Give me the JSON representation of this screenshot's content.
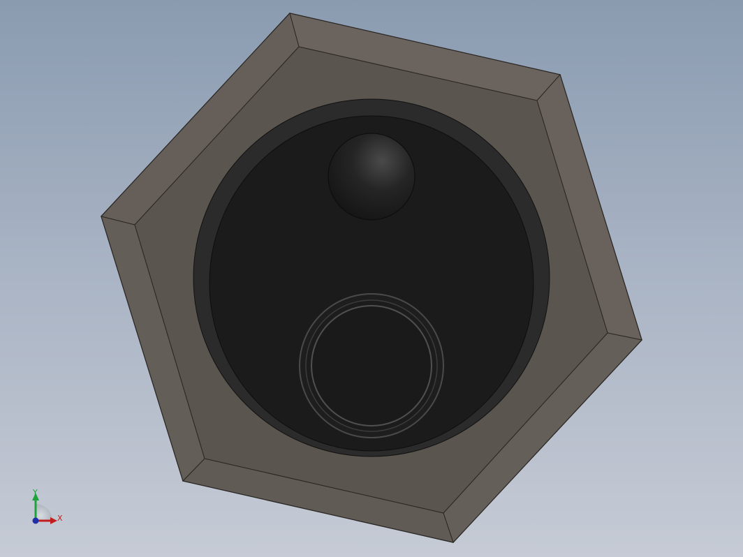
{
  "triad": {
    "y_label": "Y",
    "x_label": "X"
  },
  "colors": {
    "background_top": "#8a9bb0",
    "background_bottom": "#c6cbd5",
    "hex_face": "#5c5650",
    "hex_bevel": "#6a635d",
    "hex_edge": "#2a2623",
    "bore": "#1a1a1a",
    "bore_wall": "#2b2b2b",
    "y_axis": "#1ea33a",
    "x_axis": "#c21d1d",
    "z_axis": "#1f2fa8"
  }
}
